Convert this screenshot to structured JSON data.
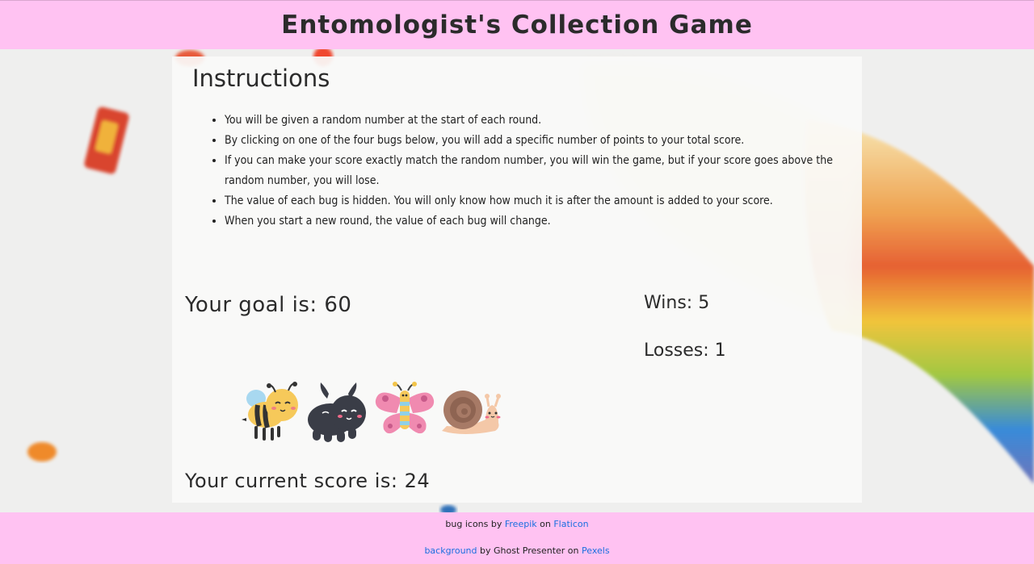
{
  "header": {
    "title": "Entomologist's Collection Game"
  },
  "instructions": {
    "title": "Instructions",
    "items": [
      "You will be given a random number at the start of each round.",
      "By clicking on one of the four bugs below, you will add a specific number of points to your total score.",
      "If you can make your score exactly match the random number, you will win the game, but if your score goes above the random number, you will lose.",
      "The value of each bug is hidden. You will only know how much it is after the amount is added to your score.",
      "When you start a new round, the value of each bug will change."
    ]
  },
  "game": {
    "goal_label": "Your goal is: 60",
    "wins_label": "Wins: 5",
    "losses_label": "Losses: 1",
    "score_label": "Your current score is: 24",
    "bugs": [
      {
        "icon": "bee-icon"
      },
      {
        "icon": "beetle-icon"
      },
      {
        "icon": "butterfly-icon"
      },
      {
        "icon": "snail-icon"
      }
    ]
  },
  "footer": {
    "line1_prefix": "bug icons by ",
    "line1_link1": "Freepik",
    "line1_mid": " on ",
    "line1_link2": "Flaticon",
    "line2_link1": "background",
    "line2_mid": " by Ghost Presenter on ",
    "line2_link2": "Pexels"
  },
  "colors": {
    "header_bg": "#ffc2f2",
    "footer_bg": "#ffc2f2",
    "link": "#1a6fe0"
  }
}
